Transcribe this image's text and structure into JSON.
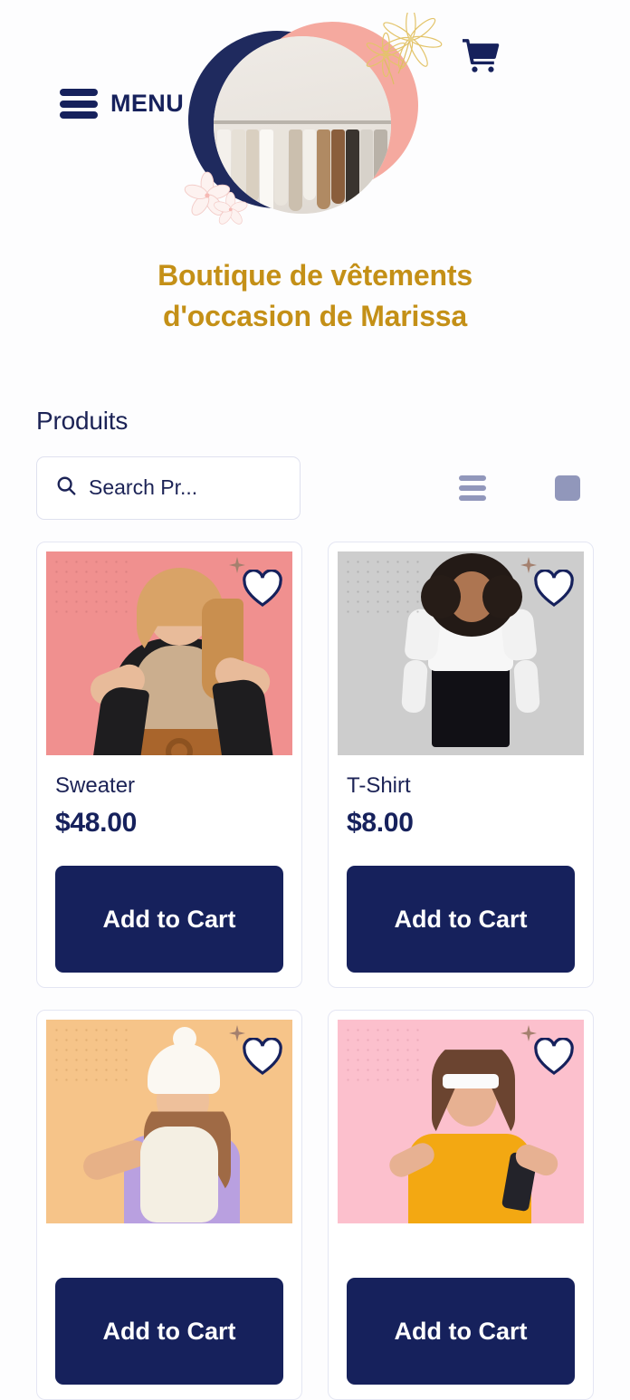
{
  "header": {
    "menu_label": "MENU",
    "menu_icon": "hamburger-icon",
    "cart_icon": "shopping-cart-icon"
  },
  "hero": {
    "image_alt": "clothing-rack-photo",
    "decor": [
      "navy-circle",
      "pink-blob",
      "gold-flower",
      "pale-flower"
    ]
  },
  "site": {
    "title_line1": "Boutique de vêtements",
    "title_line2": "d'occasion de Marissa",
    "title_color": "#c49017"
  },
  "products_section": {
    "heading": "Produits",
    "search": {
      "placeholder": "Search Pr...",
      "value": "",
      "icon": "search-icon"
    },
    "view_toggles": [
      {
        "name": "list-view",
        "icon": "list-icon",
        "active": false
      },
      {
        "name": "grid-view",
        "icon": "grid-icon",
        "active": true
      },
      {
        "name": "single-view",
        "icon": "square-icon",
        "active": false
      }
    ]
  },
  "products": [
    {
      "name": "Sweater",
      "price": "$48.00",
      "add_label": "Add to Cart",
      "favorite_icon": "heart-icon",
      "bg": "#f0908f"
    },
    {
      "name": "T-Shirt",
      "price": "$8.00",
      "add_label": "Add to Cart",
      "favorite_icon": "heart-icon",
      "bg": "#cdcdcd"
    },
    {
      "name": "",
      "price": "",
      "add_label": "Add to Cart",
      "favorite_icon": "heart-icon",
      "bg": "#f6c489"
    },
    {
      "name": "",
      "price": "",
      "add_label": "Add to Cart",
      "favorite_icon": "heart-icon",
      "bg": "#fcc0cd"
    }
  ],
  "colors": {
    "navy": "#16215c",
    "gold": "#c49017",
    "muted": "#9197bb",
    "border": "#e4e6f3"
  }
}
